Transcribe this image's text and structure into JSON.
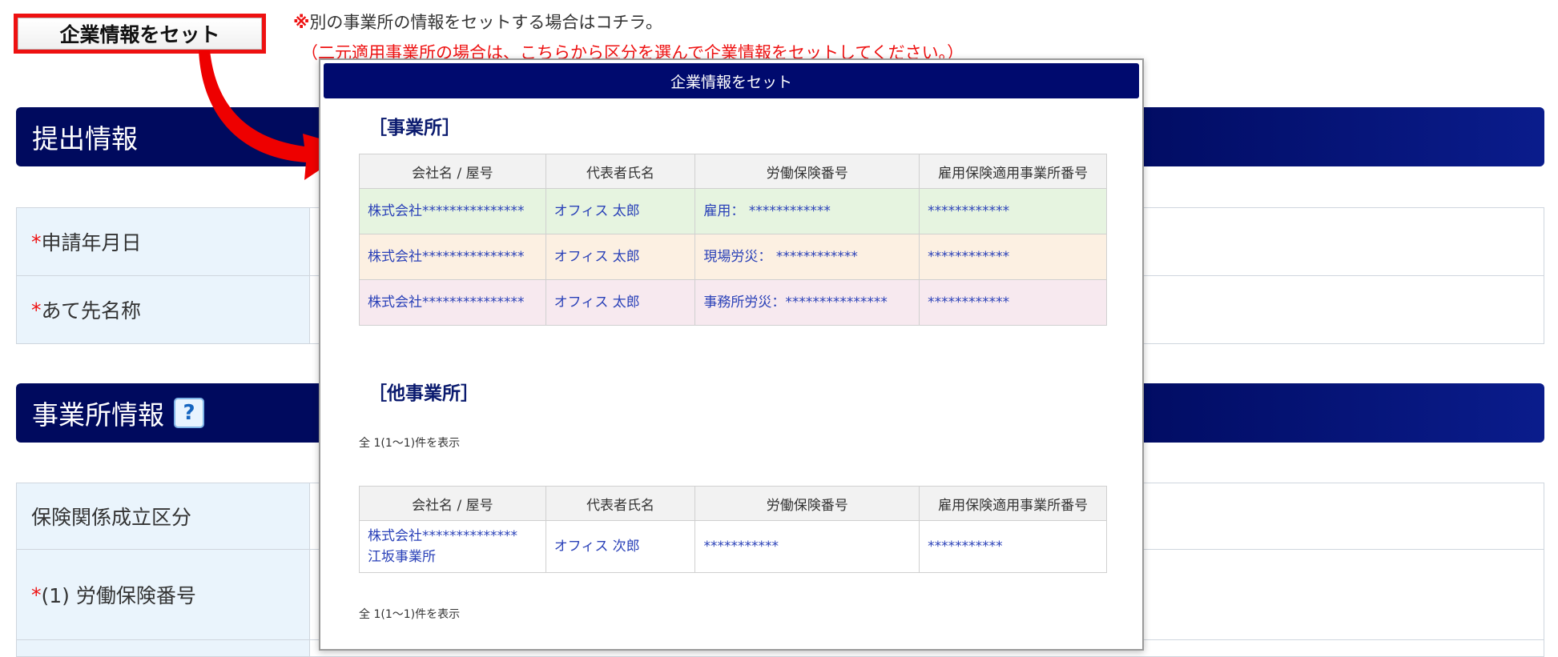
{
  "top": {
    "set_button": "企業情報をセット",
    "note_mark": "※",
    "note_line1": "別の事業所の情報をセットする場合はコチラ。",
    "note_line2": "（二元適用事業所の場合は、こちらから区分を選んで企業情報をセットしてください。）"
  },
  "sections": {
    "submission_title": "提出情報",
    "office_title": "事業所情報",
    "help_icon": "?"
  },
  "form": {
    "required_mark": "*",
    "application_date": "申請年月日",
    "recipient_name": "あて先名称",
    "insurance_category": "保険関係成立区分",
    "labor_insurance_number": "(1) 労働保険番号"
  },
  "dialog": {
    "title": "企業情報をセット",
    "offices_heading": "［事業所］",
    "other_offices_heading": "［他事業所］",
    "columns": [
      "会社名 / 屋号",
      "代表者氏名",
      "労働保険番号",
      "雇用保険適用事業所番号"
    ],
    "offices": [
      {
        "company": "株式会社***************",
        "rep": "オフィス 太郎",
        "labor_no": "雇用： ************",
        "employment_no": "************"
      },
      {
        "company": "株式会社***************",
        "rep": "オフィス 太郎",
        "labor_no": "現場労災： ************",
        "employment_no": "************"
      },
      {
        "company": "株式会社***************",
        "rep": "オフィス 太郎",
        "labor_no": "事務所労災：***************",
        "employment_no": "************"
      }
    ],
    "count_text_1": "全 1(1〜1)件を表示",
    "other_offices": [
      {
        "company": "株式会社**************　江坂事業所",
        "rep": "オフィス 次郎",
        "labor_no": "***********",
        "employment_no": "***********"
      }
    ],
    "count_text_2": "全 1(1〜1)件を表示"
  }
}
